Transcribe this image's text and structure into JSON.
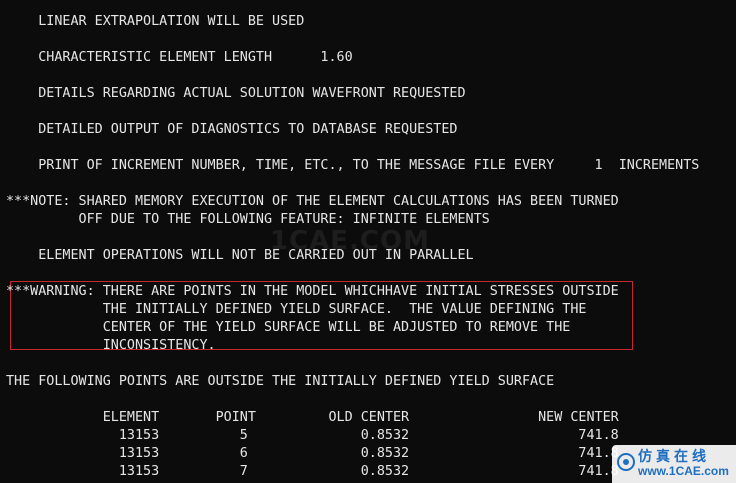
{
  "console": {
    "lines": [
      "    LINEAR EXTRAPOLATION WILL BE USED",
      "    CHARACTERISTIC ELEMENT LENGTH      1.60",
      "    DETAILS REGARDING ACTUAL SOLUTION WAVEFRONT REQUESTED",
      "    DETAILED OUTPUT OF DIAGNOSTICS TO DATABASE REQUESTED",
      "    PRINT OF INCREMENT NUMBER, TIME, ETC., TO THE MESSAGE FILE EVERY     1  INCREMENTS",
      "***NOTE: SHARED MEMORY EXECUTION OF THE ELEMENT CALCULATIONS HAS BEEN TURNED",
      "         OFF DUE TO THE FOLLOWING FEATURE: INFINITE ELEMENTS",
      "    ELEMENT OPERATIONS WILL NOT BE CARRIED OUT IN PARALLEL",
      "***WARNING: THERE ARE POINTS IN THE MODEL WHICHHAVE INITIAL STRESSES OUTSIDE",
      "            THE INITIALLY DEFINED YIELD SURFACE.  THE VALUE DEFINING THE",
      "            CENTER OF THE YIELD SURFACE WILL BE ADJUSTED TO REMOVE THE",
      "            INCONSISTENCY.",
      "THE FOLLOWING POINTS ARE OUTSIDE THE INITIALLY DEFINED YIELD SURFACE",
      "            ELEMENT       POINT         OLD CENTER                NEW CENTER",
      "              13153          5              0.8532                     741.8",
      "              13153          6              0.8532                     741.8",
      "              13153          7              0.8532                     741.8"
    ]
  },
  "watermark": {
    "center_text": "1CAE.COM",
    "corner_cn": "仿真在线",
    "corner_url": "www.1CAE.com"
  },
  "colors": {
    "background": "#0c0c0c",
    "text": "#e6e6e6",
    "highlight_border": "#c6262e",
    "watermark_blue": "#1f6fc1"
  }
}
